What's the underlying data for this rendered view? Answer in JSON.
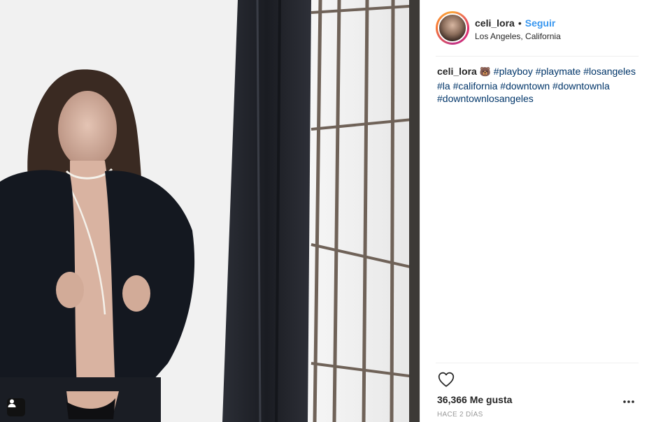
{
  "post": {
    "author": {
      "username": "celi_lora",
      "separator": "•",
      "follow_label": "Seguir",
      "location": "Los Angeles, California"
    },
    "caption": {
      "username": "celi_lora",
      "emoji": "🐻",
      "hashtags": [
        "#playboy",
        "#playmate",
        "#losangeles",
        "#la",
        "#california",
        "#downtown",
        "#downtownla",
        "#downtownlosangeles"
      ]
    },
    "likes_text": "36,366 Me gusta",
    "timestamp": "HACE 2 DÍAS"
  },
  "icons": {
    "like": "heart-outline-icon",
    "more": "more-options-icon",
    "tag": "tagged-user-icon"
  },
  "colors": {
    "accent": "#3897f0",
    "hashtag": "#003569",
    "text": "#262626",
    "muted": "#999999"
  }
}
